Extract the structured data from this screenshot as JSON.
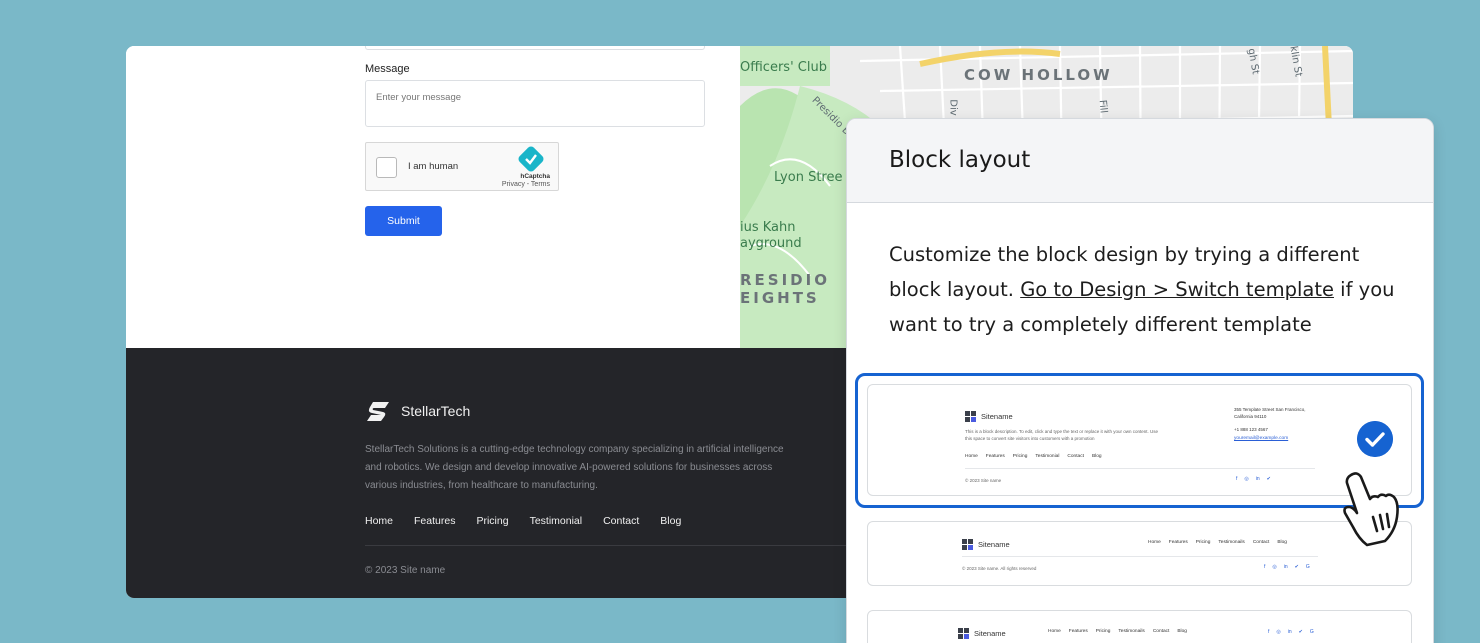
{
  "form": {
    "message_label": "Message",
    "message_placeholder": "Enter your message",
    "captcha_label": "I am human",
    "captcha_brand": "hCaptcha",
    "captcha_links": "Privacy - Terms",
    "submit_label": "Submit"
  },
  "map": {
    "labels": [
      "Officers' Club",
      "COW HOLLOW",
      "Presidio Blvd",
      "Lyon Stree",
      "ius Kahn",
      "ayground",
      "RESIDIO",
      "EIGHTS",
      "Div",
      "Fill",
      "gh St",
      "klin St"
    ]
  },
  "footer": {
    "brand": "StellarTech",
    "description": "StellarTech Solutions is a cutting-edge technology company specializing in artificial intelligence and robotics. We design and develop innovative AI-powered solutions for businesses across various industries, from healthcare to manufacturing.",
    "nav": [
      "Home",
      "Features",
      "Pricing",
      "Testimonial",
      "Contact",
      "Blog"
    ],
    "copyright": "© 2023 Site name"
  },
  "panel": {
    "title": "Block layout",
    "desc_before": "Customize the block design by trying a different block layout. ",
    "desc_link": "Go to Design > Switch template",
    "desc_after": " if you want to try a completely different template",
    "templates": [
      {
        "sitename": "Sitename",
        "description": "This is a block description. To edit, click and type the text or replace it with your own content. Use this space to convert site visitors into customers with a promotion",
        "address": "355 Template Street San Francisco, California 94110",
        "phone": "+1 888 123 4567",
        "email": "youremail@example.com",
        "nav": [
          "Home",
          "Features",
          "Pricing",
          "Testimonial",
          "Contact",
          "Blog"
        ],
        "copyright": "© 2023 Site name",
        "social": [
          "f",
          "◎",
          "in",
          "✔"
        ],
        "selected": true
      },
      {
        "sitename": "Sitename",
        "nav": [
          "Home",
          "Features",
          "Pricing",
          "Testimonails",
          "Contact",
          "Blog"
        ],
        "copyright": "© 2023 Site name. All rights reserved",
        "social": [
          "f",
          "◎",
          "in",
          "✔",
          "G"
        ]
      },
      {
        "sitename": "Sitename",
        "nav": [
          "Home",
          "Features",
          "Pricing",
          "Testimonails",
          "Contact",
          "Blog"
        ],
        "social": [
          "f",
          "◎",
          "in",
          "✔",
          "G"
        ]
      }
    ]
  },
  "colors": {
    "background": "#7ab8c8",
    "accent": "#2563eb",
    "selection": "#1663d1",
    "footer": "#242529"
  }
}
